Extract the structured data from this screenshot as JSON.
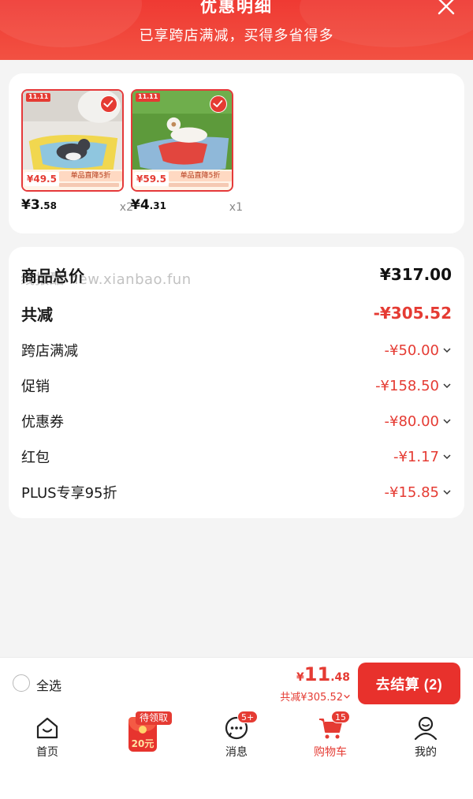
{
  "header": {
    "title": "优惠明细",
    "subtitle": "已享跨店满减，买得多省得多"
  },
  "products": [
    {
      "badge": "11.11",
      "tag_price": "¥49.5",
      "tag_promo": "单品直降5折",
      "unit_price_int": "¥3",
      "unit_price_dec": ".58",
      "quantity": "x2",
      "selected": true
    },
    {
      "badge": "11.11",
      "tag_price": "¥59.5",
      "tag_promo": "单品直降5折",
      "unit_price_int": "¥4",
      "unit_price_dec": ".31",
      "quantity": "x1",
      "selected": true
    }
  ],
  "summary": {
    "watermark": "线报酷 new.xianbao.fun",
    "rows": [
      {
        "label": "商品总价",
        "amount": "¥317.00"
      },
      {
        "label": "共减",
        "amount": "-¥305.52"
      },
      {
        "label": "跨店满减",
        "amount": "-¥50.00"
      },
      {
        "label": "促销",
        "amount": "-¥158.50"
      },
      {
        "label": "优惠券",
        "amount": "-¥80.00"
      },
      {
        "label": "红包",
        "amount": "-¥1.17"
      },
      {
        "label": "PLUS专享95折",
        "amount": "-¥15.85"
      }
    ]
  },
  "checkout": {
    "select_all": "全选",
    "price_symbol": "¥",
    "price_int": "11",
    "price_dec": ".48",
    "saved": "共减¥305.52",
    "button": "去结算 (2)"
  },
  "tabbar": {
    "items": [
      {
        "label": "首页",
        "icon": "home-icon"
      },
      {
        "label": "",
        "icon": "red-envelope-icon"
      },
      {
        "label": "消息",
        "icon": "message-icon",
        "badge": "5+"
      },
      {
        "label": "购物车",
        "icon": "cart-icon",
        "badge": "15"
      },
      {
        "label": "我的",
        "icon": "profile-icon"
      }
    ],
    "envelope_badge": "待领取",
    "envelope_amount": "20元"
  },
  "colors": {
    "accent": "#e53b33",
    "header": "#ef3a33",
    "background": "#f4f4f4"
  }
}
